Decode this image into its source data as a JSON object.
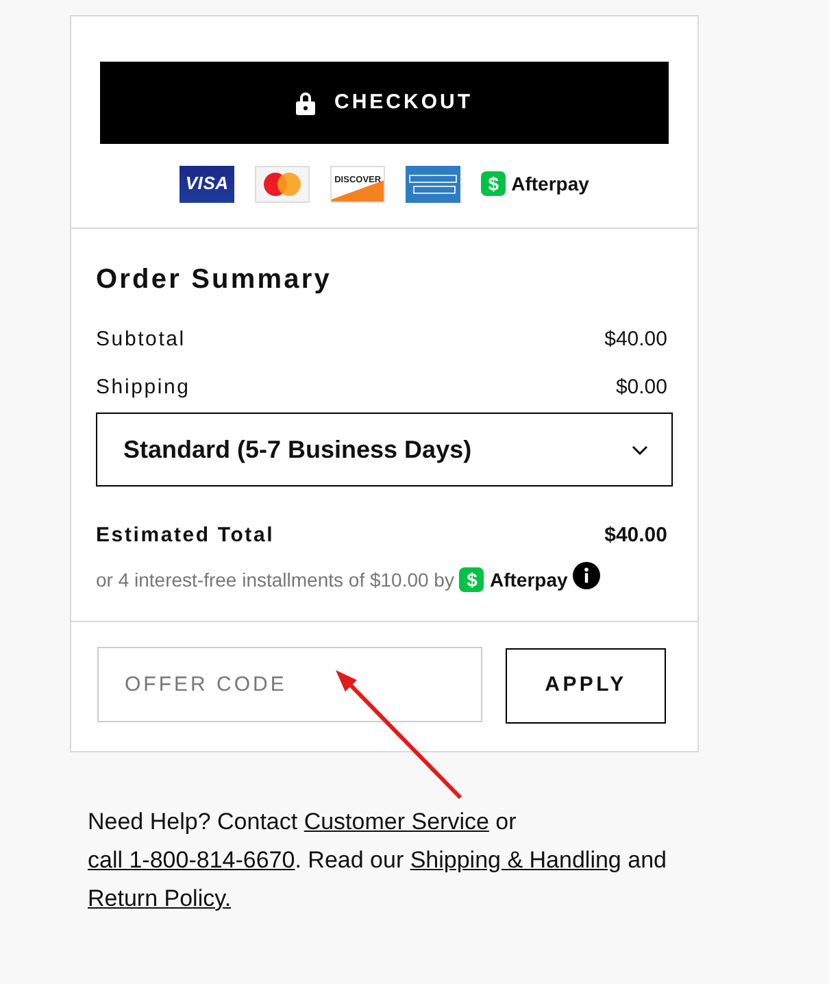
{
  "checkout_button": {
    "label": "CHECKOUT"
  },
  "payment_methods": [
    {
      "kind": "visa",
      "label": "VISA"
    },
    {
      "kind": "mastercard"
    },
    {
      "kind": "discover",
      "label": "DISCOVER"
    },
    {
      "kind": "amex"
    },
    {
      "kind": "afterpay",
      "symbol": "$",
      "label": "Afterpay"
    }
  ],
  "order_summary": {
    "title": "Order Summary",
    "lines": [
      {
        "label": "Subtotal",
        "value": "$40.00"
      },
      {
        "label": "Shipping",
        "value": "$0.00"
      }
    ],
    "shipping_select": {
      "value": "Standard (5-7 Business Days)"
    },
    "total": {
      "label": "Estimated Total",
      "value": "$40.00"
    },
    "installments": {
      "text": "or 4 interest-free installments of $10.00 by",
      "symbol": "$",
      "provider": "Afterpay"
    }
  },
  "offer_code": {
    "placeholder": "OFFER CODE",
    "button": "APPLY"
  },
  "help": {
    "parts": [
      {
        "kind": "text",
        "text": "Need Help? Contact "
      },
      {
        "kind": "link",
        "text": "Customer Service"
      },
      {
        "kind": "text",
        "text": " or "
      },
      {
        "kind": "link",
        "text": "call 1-800-814-6670"
      },
      {
        "kind": "text",
        "text": ". Read our "
      },
      {
        "kind": "link",
        "text": "Shipping & Handling"
      },
      {
        "kind": "text",
        "text": " and "
      },
      {
        "kind": "link",
        "text": "Return Policy."
      }
    ]
  },
  "annotation": {
    "kind": "arrow"
  }
}
